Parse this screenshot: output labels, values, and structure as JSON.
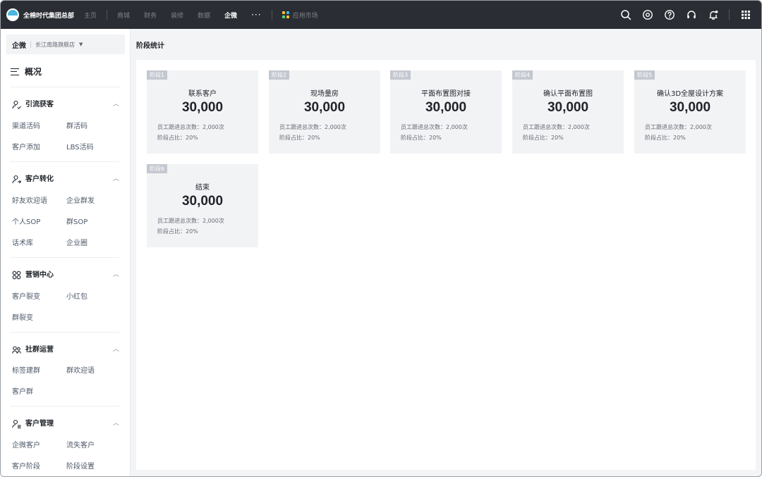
{
  "brand": {
    "name": "全棉时代集团总部"
  },
  "top_nav": [
    "主页",
    "商城",
    "财务",
    "装修",
    "数据",
    "企微"
  ],
  "top_nav_active": "企微",
  "more_label": "···",
  "app_market": {
    "label": "应用市场",
    "colors": [
      "#f5c233",
      "#3fb5ef",
      "#5ad07a",
      "#f5c233"
    ]
  },
  "toolbar_icons": [
    "search-icon",
    "settings-icon",
    "help-icon",
    "headset-icon",
    "notification-icon",
    "apps-grid-icon"
  ],
  "sidebar": {
    "org_tag": "企微",
    "org_name": "长江南路旗舰店",
    "overview_label": "概况",
    "groups": [
      {
        "label": "引流获客",
        "icon": "user-add-icon",
        "items": [
          "渠道活码",
          "群活码",
          "客户添加",
          "LBS活码"
        ]
      },
      {
        "label": "客户转化",
        "icon": "user-convert-icon",
        "items": [
          "好友欢迎语",
          "企业群发",
          "个人SOP",
          "群SOP",
          "话术库",
          "企业圈"
        ]
      },
      {
        "label": "营销中心",
        "icon": "marketing-icon",
        "items": [
          "客户裂变",
          "小红包",
          "群裂变"
        ]
      },
      {
        "label": "社群运营",
        "icon": "community-icon",
        "items": [
          "标签建群",
          "群欢迎语",
          "客户群"
        ]
      },
      {
        "label": "客户管理",
        "icon": "customer-manage-icon",
        "items": [
          "企微客户",
          "流失客户",
          "客户阶段",
          "阶段设置"
        ]
      }
    ]
  },
  "main": {
    "title": "阶段统计",
    "cards": [
      {
        "tag": "阶段1",
        "name": "联系客户",
        "value": "30,000",
        "follow": "员工跟进总次数：2,000次",
        "ratio": "阶段占比：20%"
      },
      {
        "tag": "阶段2",
        "name": "现场量房",
        "value": "30,000",
        "follow": "员工跟进总次数：2,000次",
        "ratio": "阶段占比：20%"
      },
      {
        "tag": "阶段3",
        "name": "平面布置图对接",
        "value": "30,000",
        "follow": "员工跟进总次数：2,000次",
        "ratio": "阶段占比：20%"
      },
      {
        "tag": "阶段4",
        "name": "确认平面布置图",
        "value": "30,000",
        "follow": "员工跟进总次数：2,000次",
        "ratio": "阶段占比：20%"
      },
      {
        "tag": "阶段5",
        "name": "确认3D全屋设计方案",
        "value": "30,000",
        "follow": "员工跟进总次数：2,000次",
        "ratio": "阶段占比：20%"
      },
      {
        "tag": "阶段6",
        "name": "结束",
        "value": "30,000",
        "follow": "员工跟进总次数：2,000次",
        "ratio": "阶段占比：20%"
      }
    ]
  },
  "colors": {
    "topbar_bg": "#2a2d33",
    "card_bg": "#f2f3f5",
    "tag_bg": "#c3c7cf",
    "page_bg": "#f3f4f6"
  }
}
